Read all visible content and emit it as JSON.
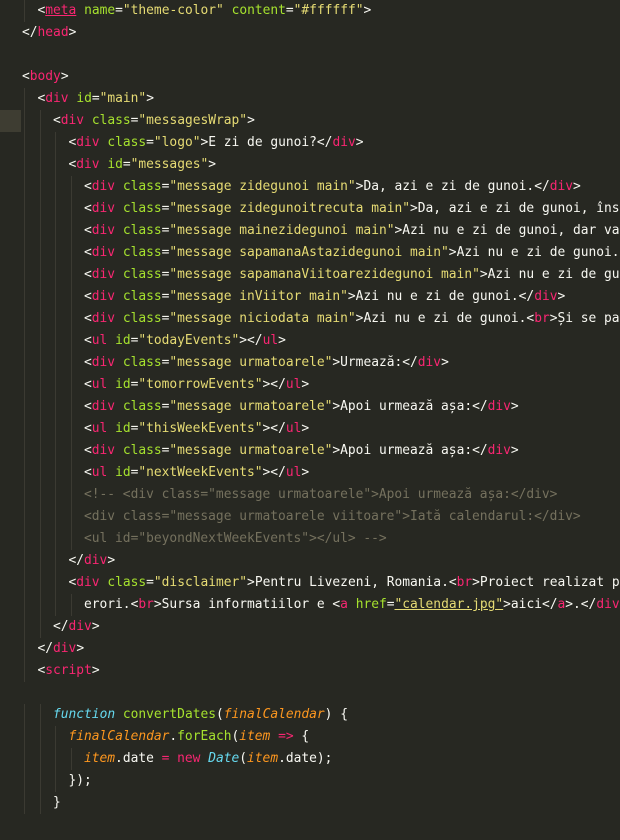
{
  "window": {
    "kind": "code-editor",
    "theme_background": "#272822"
  },
  "colors": {
    "tag": "#f92672",
    "attribute": "#a6e22e",
    "string": "#e6db74",
    "text": "#f8f8f2",
    "comment": "#75715e",
    "keyword": "#66d9ef",
    "parameter": "#fd971f"
  },
  "lines": [
    {
      "indent": 2,
      "tokens": [
        [
          "pun",
          "<"
        ],
        [
          "tag link",
          "meta"
        ],
        [
          "txt",
          " "
        ],
        [
          "attr",
          "name"
        ],
        [
          "pun",
          "="
        ],
        [
          "str",
          "\"theme-color\""
        ],
        [
          "txt",
          " "
        ],
        [
          "attr",
          "content"
        ],
        [
          "pun",
          "="
        ],
        [
          "str",
          "\"#ffffff\""
        ],
        [
          "pun",
          ">"
        ]
      ]
    },
    {
      "indent": 1,
      "tokens": [
        [
          "pun",
          "</"
        ],
        [
          "tag",
          "head"
        ],
        [
          "pun",
          ">"
        ]
      ]
    },
    {
      "indent": 0,
      "tokens": []
    },
    {
      "indent": 1,
      "tokens": [
        [
          "pun",
          "<"
        ],
        [
          "tag",
          "body"
        ],
        [
          "pun",
          ">"
        ]
      ]
    },
    {
      "indent": 2,
      "tokens": [
        [
          "pun",
          "<"
        ],
        [
          "tag",
          "div"
        ],
        [
          "txt",
          " "
        ],
        [
          "attr",
          "id"
        ],
        [
          "pun",
          "="
        ],
        [
          "str",
          "\"main\""
        ],
        [
          "pun",
          ">"
        ]
      ]
    },
    {
      "indent": 3,
      "current": true,
      "tokens": [
        [
          "pun",
          "<"
        ],
        [
          "tag",
          "div"
        ],
        [
          "txt",
          " "
        ],
        [
          "attr",
          "class"
        ],
        [
          "pun",
          "="
        ],
        [
          "str",
          "\"messagesWrap\""
        ],
        [
          "pun",
          ">"
        ]
      ]
    },
    {
      "indent": 4,
      "tokens": [
        [
          "pun",
          "<"
        ],
        [
          "tag",
          "div"
        ],
        [
          "txt",
          " "
        ],
        [
          "attr",
          "class"
        ],
        [
          "pun",
          "="
        ],
        [
          "str",
          "\"logo\""
        ],
        [
          "pun",
          ">"
        ],
        [
          "txt",
          "E zi de gunoi?"
        ],
        [
          "pun",
          "</"
        ],
        [
          "tag",
          "div"
        ],
        [
          "pun",
          ">"
        ]
      ]
    },
    {
      "indent": 4,
      "tokens": [
        [
          "pun",
          "<"
        ],
        [
          "tag",
          "div"
        ],
        [
          "txt",
          " "
        ],
        [
          "attr",
          "id"
        ],
        [
          "pun",
          "="
        ],
        [
          "str",
          "\"messages\""
        ],
        [
          "pun",
          ">"
        ]
      ]
    },
    {
      "indent": 5,
      "tokens": [
        [
          "pun",
          "<"
        ],
        [
          "tag",
          "div"
        ],
        [
          "txt",
          " "
        ],
        [
          "attr",
          "class"
        ],
        [
          "pun",
          "="
        ],
        [
          "str",
          "\"message zidegunoi main\""
        ],
        [
          "pun",
          ">"
        ],
        [
          "txt",
          "Da, azi e zi de gunoi."
        ],
        [
          "pun",
          "</"
        ],
        [
          "tag",
          "div"
        ],
        [
          "pun",
          ">"
        ]
      ]
    },
    {
      "indent": 5,
      "tokens": [
        [
          "pun",
          "<"
        ],
        [
          "tag",
          "div"
        ],
        [
          "txt",
          " "
        ],
        [
          "attr",
          "class"
        ],
        [
          "pun",
          "="
        ],
        [
          "str",
          "\"message zidegunoitrecuta main\""
        ],
        [
          "pun",
          ">"
        ],
        [
          "txt",
          "Da, azi e zi de gunoi, însă"
        ]
      ]
    },
    {
      "indent": 5,
      "tokens": [
        [
          "pun",
          "<"
        ],
        [
          "tag",
          "div"
        ],
        [
          "txt",
          " "
        ],
        [
          "attr",
          "class"
        ],
        [
          "pun",
          "="
        ],
        [
          "str",
          "\"message mainezidegunoi main\""
        ],
        [
          "pun",
          ">"
        ],
        [
          "txt",
          "Azi nu e zi de gunoi, dar va"
        ]
      ]
    },
    {
      "indent": 5,
      "tokens": [
        [
          "pun",
          "<"
        ],
        [
          "tag",
          "div"
        ],
        [
          "txt",
          " "
        ],
        [
          "attr",
          "class"
        ],
        [
          "pun",
          "="
        ],
        [
          "str",
          "\"message sapamanaAstazidegunoi main\""
        ],
        [
          "pun",
          ">"
        ],
        [
          "txt",
          "Azi nu e zi de gunoi.<"
        ]
      ]
    },
    {
      "indent": 5,
      "tokens": [
        [
          "pun",
          "<"
        ],
        [
          "tag",
          "div"
        ],
        [
          "txt",
          " "
        ],
        [
          "attr",
          "class"
        ],
        [
          "pun",
          "="
        ],
        [
          "str",
          "\"message sapamanaViitoarezidegunoi main\""
        ],
        [
          "pun",
          ">"
        ],
        [
          "txt",
          "Azi nu e zi de gun"
        ]
      ]
    },
    {
      "indent": 5,
      "tokens": [
        [
          "pun",
          "<"
        ],
        [
          "tag",
          "div"
        ],
        [
          "txt",
          " "
        ],
        [
          "attr",
          "class"
        ],
        [
          "pun",
          "="
        ],
        [
          "str",
          "\"message inViitor main\""
        ],
        [
          "pun",
          ">"
        ],
        [
          "txt",
          "Azi nu e zi de gunoi."
        ],
        [
          "pun",
          "</"
        ],
        [
          "tag",
          "div"
        ],
        [
          "pun",
          ">"
        ]
      ]
    },
    {
      "indent": 5,
      "tokens": [
        [
          "pun",
          "<"
        ],
        [
          "tag",
          "div"
        ],
        [
          "txt",
          " "
        ],
        [
          "attr",
          "class"
        ],
        [
          "pun",
          "="
        ],
        [
          "str",
          "\"message niciodata main\""
        ],
        [
          "pun",
          ">"
        ],
        [
          "txt",
          "Azi nu e zi de gunoi."
        ],
        [
          "pun",
          "<"
        ],
        [
          "tag",
          "br"
        ],
        [
          "pun",
          ">"
        ],
        [
          "txt",
          "Și se par"
        ]
      ]
    },
    {
      "indent": 5,
      "tokens": [
        [
          "pun",
          "<"
        ],
        [
          "tag",
          "ul"
        ],
        [
          "txt",
          " "
        ],
        [
          "attr",
          "id"
        ],
        [
          "pun",
          "="
        ],
        [
          "str",
          "\"todayEvents\""
        ],
        [
          "pun",
          "></"
        ],
        [
          "tag",
          "ul"
        ],
        [
          "pun",
          ">"
        ]
      ]
    },
    {
      "indent": 5,
      "tokens": [
        [
          "pun",
          "<"
        ],
        [
          "tag",
          "div"
        ],
        [
          "txt",
          " "
        ],
        [
          "attr",
          "class"
        ],
        [
          "pun",
          "="
        ],
        [
          "str",
          "\"message urmatoarele\""
        ],
        [
          "pun",
          ">"
        ],
        [
          "txt",
          "Urmează:"
        ],
        [
          "pun",
          "</"
        ],
        [
          "tag",
          "div"
        ],
        [
          "pun",
          ">"
        ]
      ]
    },
    {
      "indent": 5,
      "tokens": [
        [
          "pun",
          "<"
        ],
        [
          "tag",
          "ul"
        ],
        [
          "txt",
          " "
        ],
        [
          "attr",
          "id"
        ],
        [
          "pun",
          "="
        ],
        [
          "str",
          "\"tomorrowEvents\""
        ],
        [
          "pun",
          "></"
        ],
        [
          "tag",
          "ul"
        ],
        [
          "pun",
          ">"
        ]
      ]
    },
    {
      "indent": 5,
      "tokens": [
        [
          "pun",
          "<"
        ],
        [
          "tag",
          "div"
        ],
        [
          "txt",
          " "
        ],
        [
          "attr",
          "class"
        ],
        [
          "pun",
          "="
        ],
        [
          "str",
          "\"message urmatoarele\""
        ],
        [
          "pun",
          ">"
        ],
        [
          "txt",
          "Apoi urmează așa:"
        ],
        [
          "pun",
          "</"
        ],
        [
          "tag",
          "div"
        ],
        [
          "pun",
          ">"
        ]
      ]
    },
    {
      "indent": 5,
      "tokens": [
        [
          "pun",
          "<"
        ],
        [
          "tag",
          "ul"
        ],
        [
          "txt",
          " "
        ],
        [
          "attr",
          "id"
        ],
        [
          "pun",
          "="
        ],
        [
          "str",
          "\"thisWeekEvents\""
        ],
        [
          "pun",
          "></"
        ],
        [
          "tag",
          "ul"
        ],
        [
          "pun",
          ">"
        ]
      ]
    },
    {
      "indent": 5,
      "tokens": [
        [
          "pun",
          "<"
        ],
        [
          "tag",
          "div"
        ],
        [
          "txt",
          " "
        ],
        [
          "attr",
          "class"
        ],
        [
          "pun",
          "="
        ],
        [
          "str",
          "\"message urmatoarele\""
        ],
        [
          "pun",
          ">"
        ],
        [
          "txt",
          "Apoi urmează așa:"
        ],
        [
          "pun",
          "</"
        ],
        [
          "tag",
          "div"
        ],
        [
          "pun",
          ">"
        ]
      ]
    },
    {
      "indent": 5,
      "tokens": [
        [
          "pun",
          "<"
        ],
        [
          "tag",
          "ul"
        ],
        [
          "txt",
          " "
        ],
        [
          "attr",
          "id"
        ],
        [
          "pun",
          "="
        ],
        [
          "str",
          "\"nextWeekEvents\""
        ],
        [
          "pun",
          "></"
        ],
        [
          "tag",
          "ul"
        ],
        [
          "pun",
          ">"
        ]
      ]
    },
    {
      "indent": 5,
      "tokens": [
        [
          "com",
          "<!-- <div class=\"message urmatoarele\">Apoi urmează așa:</div>"
        ]
      ]
    },
    {
      "indent": 5,
      "tokens": [
        [
          "com",
          "<div class=\"message urmatoarele viitoare\">Iată calendarul:</div>"
        ]
      ]
    },
    {
      "indent": 5,
      "tokens": [
        [
          "com",
          "<ul id=\"beyondNextWeekEvents\"></ul> -->"
        ]
      ]
    },
    {
      "indent": 4,
      "tokens": [
        [
          "pun",
          "</"
        ],
        [
          "tag",
          "div"
        ],
        [
          "pun",
          ">"
        ]
      ]
    },
    {
      "indent": 4,
      "tokens": [
        [
          "pun",
          "<"
        ],
        [
          "tag",
          "div"
        ],
        [
          "txt",
          " "
        ],
        [
          "attr",
          "class"
        ],
        [
          "pun",
          "="
        ],
        [
          "str",
          "\"disclaimer\""
        ],
        [
          "pun",
          ">"
        ],
        [
          "txt",
          "Pentru Livezeni, Romania."
        ],
        [
          "pun",
          "<"
        ],
        [
          "tag",
          "br"
        ],
        [
          "pun",
          ">"
        ],
        [
          "txt",
          "Proiect realizat pe"
        ]
      ]
    },
    {
      "indent": 5,
      "tokens": [
        [
          "txt",
          "erori."
        ],
        [
          "pun",
          "<"
        ],
        [
          "tag",
          "br"
        ],
        [
          "pun",
          ">"
        ],
        [
          "txt",
          "Sursa informatiilor e "
        ],
        [
          "pun",
          "<"
        ],
        [
          "tag",
          "a"
        ],
        [
          "txt",
          " "
        ],
        [
          "attr",
          "href"
        ],
        [
          "pun",
          "="
        ],
        [
          "str link",
          "\"calendar.jpg\""
        ],
        [
          "pun",
          ">"
        ],
        [
          "txt",
          "aici"
        ],
        [
          "pun",
          "</"
        ],
        [
          "tag",
          "a"
        ],
        [
          "pun",
          ">"
        ],
        [
          "txt",
          "."
        ],
        [
          "pun",
          "</"
        ],
        [
          "tag",
          "div"
        ],
        [
          "pun",
          ">"
        ]
      ]
    },
    {
      "indent": 3,
      "tokens": [
        [
          "pun",
          "</"
        ],
        [
          "tag",
          "div"
        ],
        [
          "pun",
          ">"
        ]
      ]
    },
    {
      "indent": 2,
      "tokens": [
        [
          "pun",
          "</"
        ],
        [
          "tag",
          "div"
        ],
        [
          "pun",
          ">"
        ]
      ]
    },
    {
      "indent": 2,
      "tokens": [
        [
          "pun",
          "<"
        ],
        [
          "tag",
          "script"
        ],
        [
          "pun",
          ">"
        ]
      ]
    },
    {
      "indent": 0,
      "tokens": []
    },
    {
      "indent": 3,
      "tokens": [
        [
          "kw",
          "function"
        ],
        [
          "txt",
          " "
        ],
        [
          "fn",
          "convertDates"
        ],
        [
          "pun",
          "("
        ],
        [
          "param",
          "finalCalendar"
        ],
        [
          "pun",
          ") {"
        ]
      ]
    },
    {
      "indent": 4,
      "tokens": [
        [
          "param",
          "finalCalendar"
        ],
        [
          "pun",
          "."
        ],
        [
          "fn",
          "forEach"
        ],
        [
          "pun",
          "("
        ],
        [
          "param",
          "item"
        ],
        [
          "txt",
          " "
        ],
        [
          "op",
          "=>"
        ],
        [
          "pun",
          " {"
        ]
      ]
    },
    {
      "indent": 5,
      "tokens": [
        [
          "param",
          "item"
        ],
        [
          "pun",
          "."
        ],
        [
          "txt",
          "date "
        ],
        [
          "op",
          "="
        ],
        [
          "txt",
          " "
        ],
        [
          "op",
          "new"
        ],
        [
          "txt",
          " "
        ],
        [
          "kw",
          "Date"
        ],
        [
          "pun",
          "("
        ],
        [
          "param",
          "item"
        ],
        [
          "pun",
          "."
        ],
        [
          "txt",
          "date"
        ],
        [
          "pun",
          ");"
        ]
      ]
    },
    {
      "indent": 4,
      "tokens": [
        [
          "pun",
          "});"
        ]
      ]
    },
    {
      "indent": 3,
      "tokens": [
        [
          "pun",
          "}"
        ]
      ]
    }
  ]
}
